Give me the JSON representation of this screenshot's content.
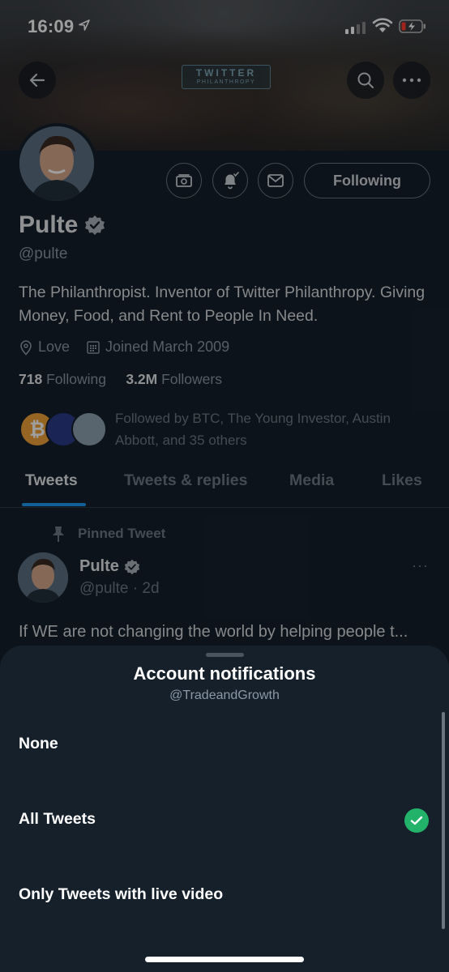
{
  "status_bar": {
    "time": "16:09"
  },
  "banner": {
    "brand_line1": "TWITTER",
    "brand_line2": "PHILANTHROPY"
  },
  "profile": {
    "name": "Pulte",
    "handle": "@pulte",
    "bio": "The Philanthropist. Inventor of Twitter Philanthropy. Giving Money, Food, and Rent to People In Need.",
    "location": "Love",
    "joined": "Joined March 2009",
    "following_count": "718",
    "following_label": "Following",
    "followers_count": "3.2M",
    "followers_label": "Followers",
    "followed_by": "Followed by BTC, The Young Investor, Austin Abbott, and 35 others",
    "follow_button": "Following"
  },
  "tabs": [
    {
      "label": "Tweets",
      "active": true
    },
    {
      "label": "Tweets & replies",
      "active": false
    },
    {
      "label": "Media",
      "active": false
    },
    {
      "label": "Likes",
      "active": false
    }
  ],
  "pinned_tweet": {
    "pinned_label": "Pinned Tweet",
    "author": "Pulte",
    "handle_time": "@pulte · 2d",
    "text": "If WE are not changing the world by helping people t...",
    "more": "···"
  },
  "sheet": {
    "title": "Account notifications",
    "subtitle": "@TradeandGrowth",
    "options": [
      {
        "label": "None",
        "selected": false
      },
      {
        "label": "All Tweets",
        "selected": true
      },
      {
        "label": "Only Tweets with live video",
        "selected": false
      }
    ]
  },
  "colors": {
    "background": "#15202b",
    "accent": "#1d9bf0",
    "check": "#23b26a",
    "muted_text": "#8b98a5"
  },
  "icons": [
    "back-arrow-icon",
    "search-icon",
    "more-icon",
    "tip-jar-icon",
    "bell-icon",
    "mail-icon",
    "verified-icon",
    "location-icon",
    "calendar-icon",
    "pin-icon",
    "checkmark-icon"
  ]
}
